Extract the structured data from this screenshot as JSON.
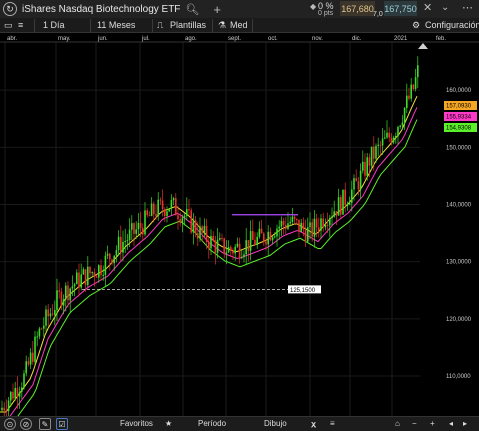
{
  "title_bar": {
    "instrument": "iShares Nasdaq Biotechnology ETF",
    "change_pct": "0 %",
    "change_pts": "0 pts",
    "bid": "167,680",
    "ask": "167,750",
    "spread": "7,0"
  },
  "toolbar": {
    "interval": "1 Día",
    "range": "11 Meses",
    "templates": "Plantillas",
    "indicator": "Med",
    "settings": "Configuración"
  },
  "bottom_bar": {
    "favorites": "Favoritos",
    "period": "Período",
    "drawing": "Dibujo"
  },
  "chart_data": {
    "type": "candlestick",
    "y_ticks": [
      "160,0000",
      "150,0000",
      "140,0000",
      "130,0000",
      "120,0000",
      "110,0000"
    ],
    "month_labels": [
      "abr.",
      "may.",
      "jun.",
      "jul.",
      "ago.",
      "sept.",
      "oct.",
      "nov.",
      "dic.",
      "2021",
      "feb."
    ],
    "ylim": [
      103,
      170
    ],
    "price_tags": [
      {
        "label": "157,0930",
        "value": 157.093,
        "color": "#f5a623"
      },
      {
        "label": "155,9334",
        "value": 155.9334,
        "color": "#ff39c8"
      },
      {
        "label": "154,9308",
        "value": 154.9308,
        "color": "#5cf02a"
      }
    ],
    "horizontal_line": {
      "label": "125,1500",
      "value": 125.15
    },
    "purple_segment": {
      "value": 138.2
    }
  }
}
